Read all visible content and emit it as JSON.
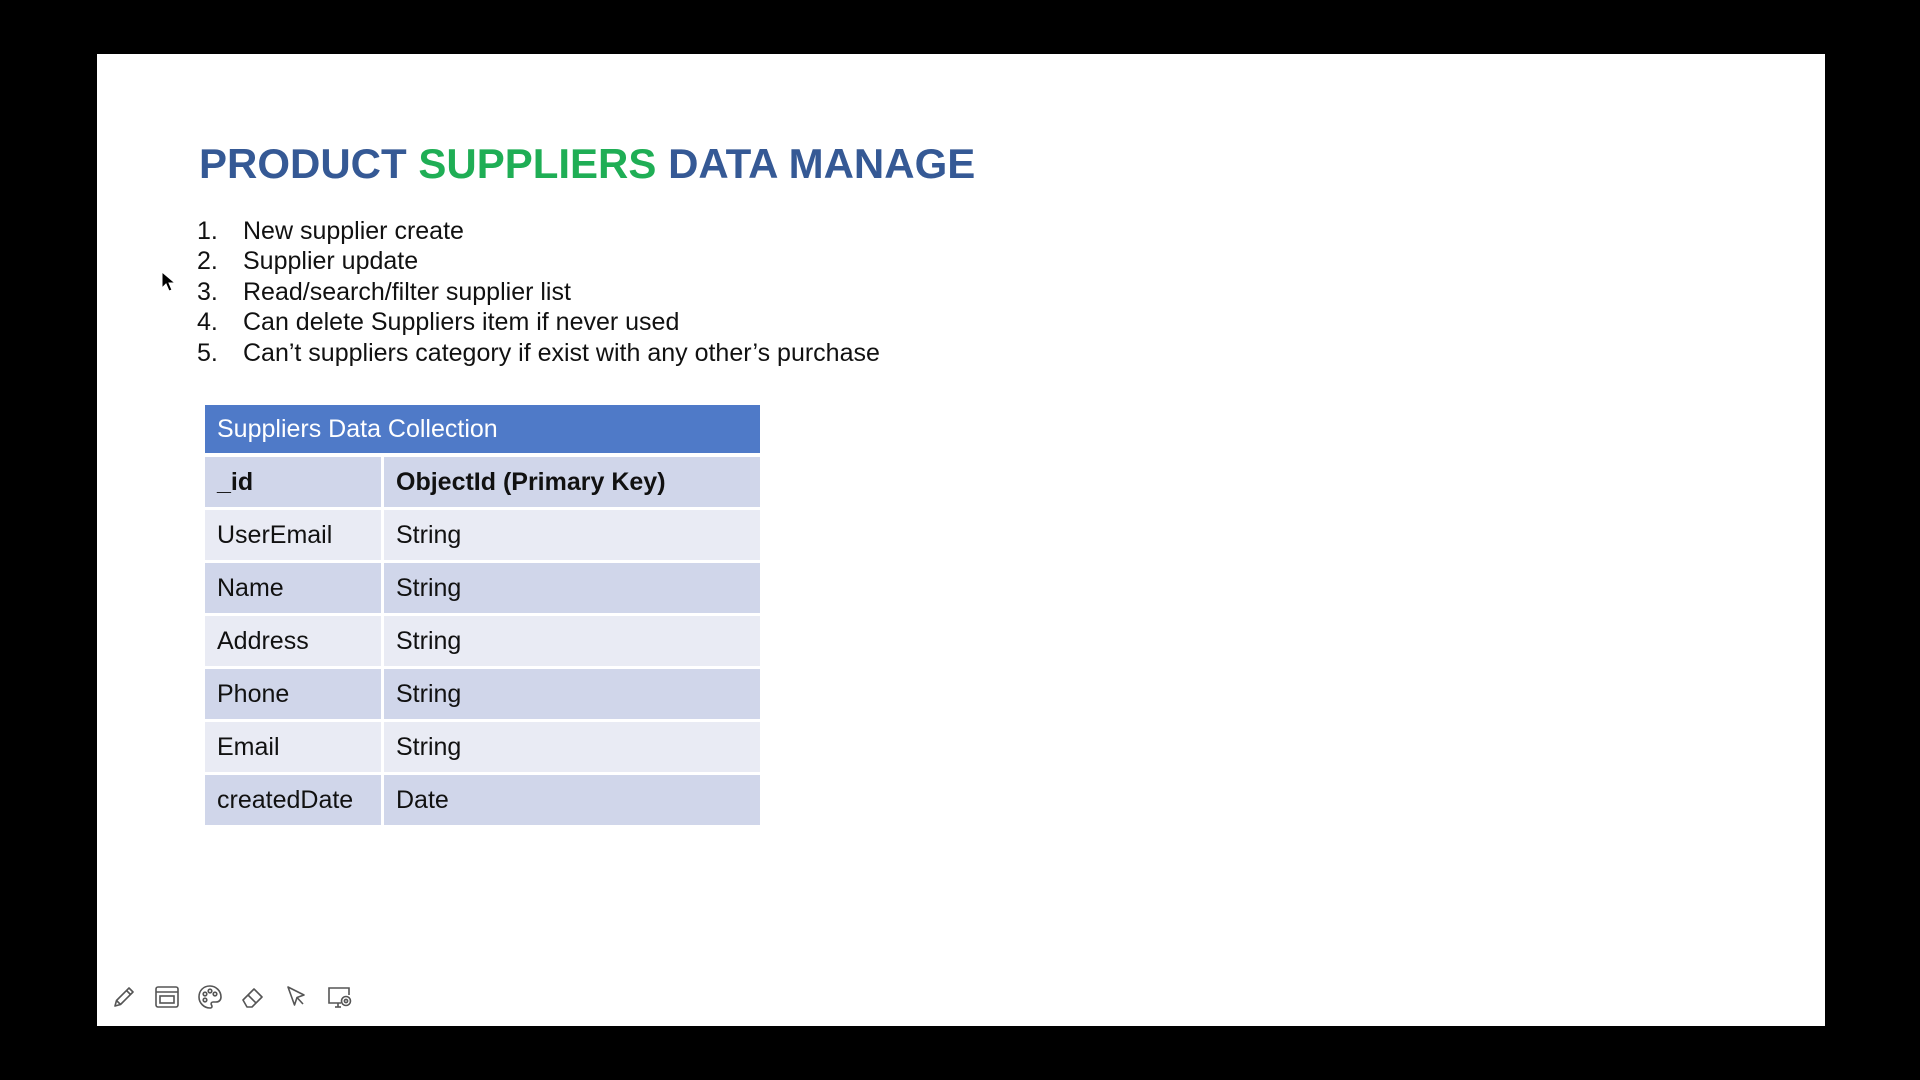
{
  "slide": {
    "title": {
      "word1": "PRODUCT",
      "word2": "SUPPLIERS",
      "word3": "DATA MANAGE",
      "colors": {
        "primary": "#355995",
        "accent": "#1fae55"
      }
    },
    "steps": [
      {
        "num": "1.",
        "text": "New supplier create"
      },
      {
        "num": "2.",
        "text": "Supplier update"
      },
      {
        "num": "3.",
        "text": "Read/search/filter supplier list"
      },
      {
        "num": "4.",
        "text": "Can delete Suppliers item if never used"
      },
      {
        "num": "5.",
        "text": "Can’t suppliers category if exist with any other’s purchase"
      }
    ],
    "table": {
      "header": "Suppliers  Data Collection",
      "header_color": "#4f7ac8",
      "rows": [
        {
          "field": "_id",
          "type": "ObjectId (Primary Key)"
        },
        {
          "field": "UserEmail",
          "type": "String"
        },
        {
          "field": "Name",
          "type": "String"
        },
        {
          "field": "Address",
          "type": "String"
        },
        {
          "field": "Phone",
          "type": "String"
        },
        {
          "field": "Email",
          "type": "String"
        },
        {
          "field": "createdDate",
          "type": "Date"
        }
      ]
    }
  },
  "toolbar": {
    "tools": [
      "pencil-icon",
      "window-icon",
      "palette-icon",
      "eraser-icon",
      "pointer-icon",
      "screen-share-icon"
    ]
  }
}
